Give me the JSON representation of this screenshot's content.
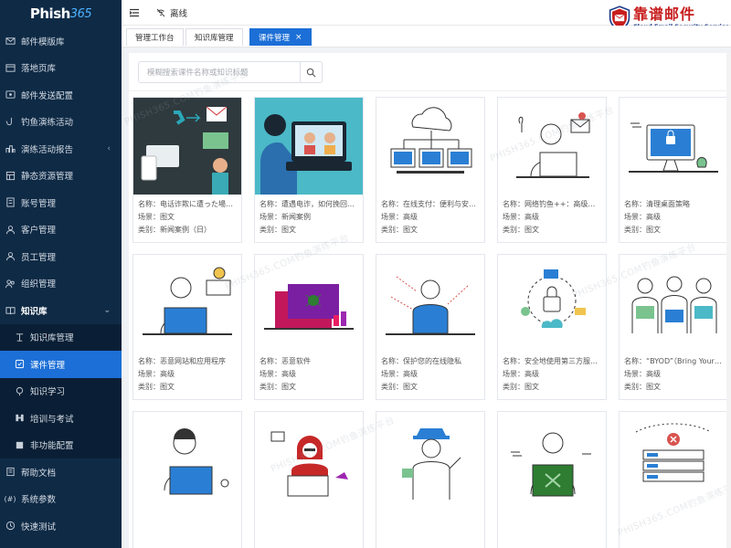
{
  "app": {
    "logo_main": "Phish",
    "logo_num": "365"
  },
  "brand": {
    "title": "靠谱邮件",
    "subtitle": "Cloud Email Security Service",
    "color": "#c81e1e"
  },
  "topbar": {
    "status": "离线"
  },
  "sidebar": {
    "items": [
      {
        "label": "邮件模版库",
        "icon": "mail-template-icon"
      },
      {
        "label": "落地页库",
        "icon": "landing-page-icon"
      },
      {
        "label": "邮件发送配置",
        "icon": "mail-send-icon"
      },
      {
        "label": "钓鱼演练活动",
        "icon": "phishing-activity-icon"
      },
      {
        "label": "演练活动报告",
        "icon": "report-icon"
      },
      {
        "label": "静态资源管理",
        "icon": "resource-icon"
      },
      {
        "label": "账号管理",
        "icon": "account-icon"
      },
      {
        "label": "客户管理",
        "icon": "customer-icon"
      },
      {
        "label": "员工管理",
        "icon": "employee-icon"
      },
      {
        "label": "组织管理",
        "icon": "organization-icon"
      },
      {
        "label": "知识库",
        "icon": "knowledge-icon"
      }
    ],
    "sub_items": [
      {
        "label": "知识库管理",
        "icon": "knowledge-manage-icon"
      },
      {
        "label": "课件管理",
        "icon": "courseware-icon"
      },
      {
        "label": "知识学习",
        "icon": "learning-icon"
      },
      {
        "label": "培训与考试",
        "icon": "exam-icon"
      },
      {
        "label": "非功能配置",
        "icon": "config-icon"
      }
    ],
    "bottom_items": [
      {
        "label": "帮助文档",
        "icon": "help-icon"
      },
      {
        "label": "系统参数",
        "icon": "system-icon"
      },
      {
        "label": "快速测试",
        "icon": "quick-test-icon"
      }
    ]
  },
  "tabs": [
    {
      "label": "管理工作台"
    },
    {
      "label": "知识库管理"
    },
    {
      "label": "课件管理",
      "close": "×"
    }
  ],
  "search": {
    "placeholder": "模糊搜索课件名称或知识标题"
  },
  "watermark": "PHISH365.COM钓鱼演练平台",
  "cards": [
    {
      "name": "名称：电话诈欺に遭った場…",
      "scene": "场景：图文",
      "category": "类别：新闻案例（日）"
    },
    {
      "name": "名称：遭遇电诈，如何挽回…",
      "scene": "场景：新闻案例",
      "category": "类别：图文"
    },
    {
      "name": "名称：在线支付：便利与安…",
      "scene": "场景：高级",
      "category": "类别：图文"
    },
    {
      "name": "名称：网络钓鱼++：高级…",
      "scene": "场景：高级",
      "category": "类别：图文"
    },
    {
      "name": "名称：清理桌面策略",
      "scene": "场景：高级",
      "category": "类别：图文"
    },
    {
      "name": "名称：恶意网站和应用程序",
      "scene": "场景：高级",
      "category": "类别：图文"
    },
    {
      "name": "名称：恶意软件",
      "scene": "场景：高级",
      "category": "类别：图文"
    },
    {
      "name": "名称：保护您的在线隐私",
      "scene": "场景：高级",
      "category": "类别：图文"
    },
    {
      "name": "名称：安全地使用第三方服…",
      "scene": "场景：高级",
      "category": "类别：图文"
    },
    {
      "name": "名称：“BYOD”（Bring Your …",
      "scene": "场景：高级",
      "category": "类别：图文"
    },
    {
      "name": "",
      "scene": "",
      "category": ""
    },
    {
      "name": "",
      "scene": "",
      "category": ""
    },
    {
      "name": "",
      "scene": "",
      "category": ""
    },
    {
      "name": "",
      "scene": "",
      "category": ""
    },
    {
      "name": "",
      "scene": "",
      "category": ""
    }
  ]
}
